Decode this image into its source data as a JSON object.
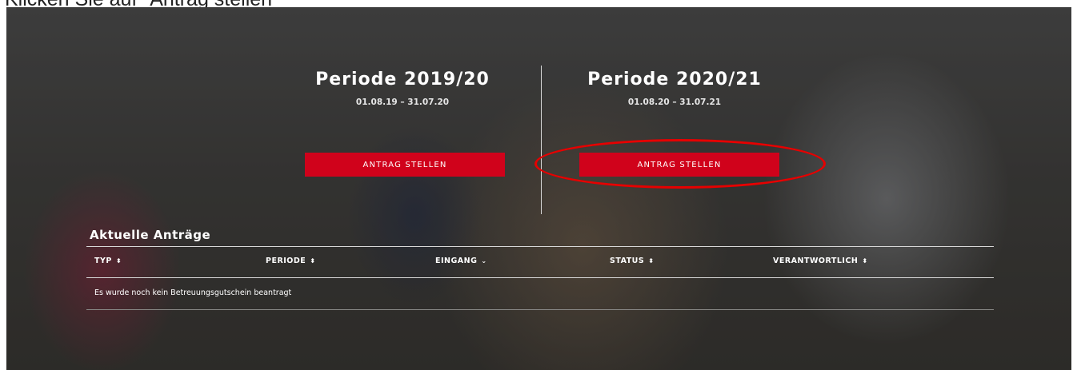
{
  "instruction": "Klicken Sie auf \"Antrag stellen\"",
  "periods": [
    {
      "title": "Periode 2019/20",
      "dates": "01.08.19 – 31.07.20",
      "button_label": "ANTRAG STELLEN"
    },
    {
      "title": "Periode 2020/21",
      "dates": "01.08.20 – 31.07.21",
      "button_label": "ANTRAG STELLEN"
    }
  ],
  "applications": {
    "title": "Aktuelle Anträge",
    "columns": [
      {
        "label": "TYP",
        "sort_icon": "⬍"
      },
      {
        "label": "PERIODE",
        "sort_icon": "⬍"
      },
      {
        "label": "EINGANG",
        "sort_icon": "⌄"
      },
      {
        "label": "STATUS",
        "sort_icon": "⬍"
      },
      {
        "label": "VERANTWORTLICH",
        "sort_icon": "⬍"
      }
    ],
    "empty_message": "Es wurde noch kein Betreuungsgutschein beantragt"
  },
  "colors": {
    "button": "#d0021b",
    "highlight": "#e60000"
  }
}
